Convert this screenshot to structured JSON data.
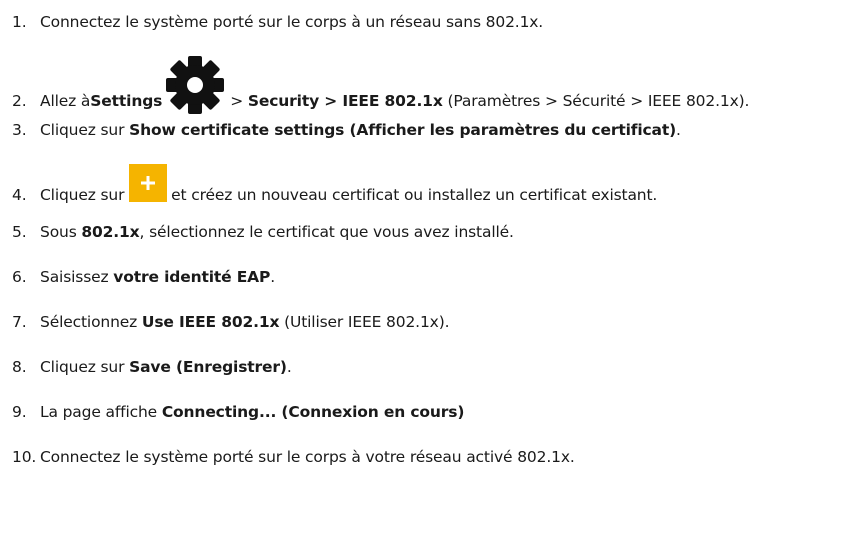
{
  "steps": [
    {
      "number": "1.",
      "parts": [
        "Connectez le système porté sur le corps à un réseau sans 802.1x."
      ]
    },
    {
      "number": "2.",
      "parts": [
        "Allez à",
        "Settings",
        "> ",
        "Security > IEEE 802.1x",
        " (Paramètres > Sécurité > IEEE 802.1x)."
      ]
    },
    {
      "number": "3.",
      "parts": [
        "Cliquez sur ",
        "Show certificate settings (Afficher les paramètres du certificat)",
        "."
      ]
    },
    {
      "number": "4.",
      "parts": [
        "Cliquez sur ",
        "et créez un nouveau certificat ou installez un certificat existant."
      ]
    },
    {
      "number": "5.",
      "parts": [
        "Sous ",
        "802.1x",
        ", sélectionnez le certificat que vous avez installé."
      ]
    },
    {
      "number": "6.",
      "parts": [
        "Saisissez ",
        "votre identité EAP",
        "."
      ]
    },
    {
      "number": "7.",
      "parts": [
        "Sélectionnez ",
        "Use IEEE 802.1x",
        " (Utiliser IEEE 802.1x)."
      ]
    },
    {
      "number": "8.",
      "parts": [
        "Cliquez sur ",
        "Save (Enregistrer)",
        "."
      ]
    },
    {
      "number": "9.",
      "parts": [
        "La page affiche ",
        "Connecting... (Connexion en cours)"
      ]
    },
    {
      "number": "10.",
      "parts": [
        "Connectez le système porté sur le corps à votre réseau activé 802.1x."
      ]
    }
  ],
  "icons": {
    "settings": "gear-icon",
    "add": "plus-icon",
    "add_color": "#f5b400"
  }
}
